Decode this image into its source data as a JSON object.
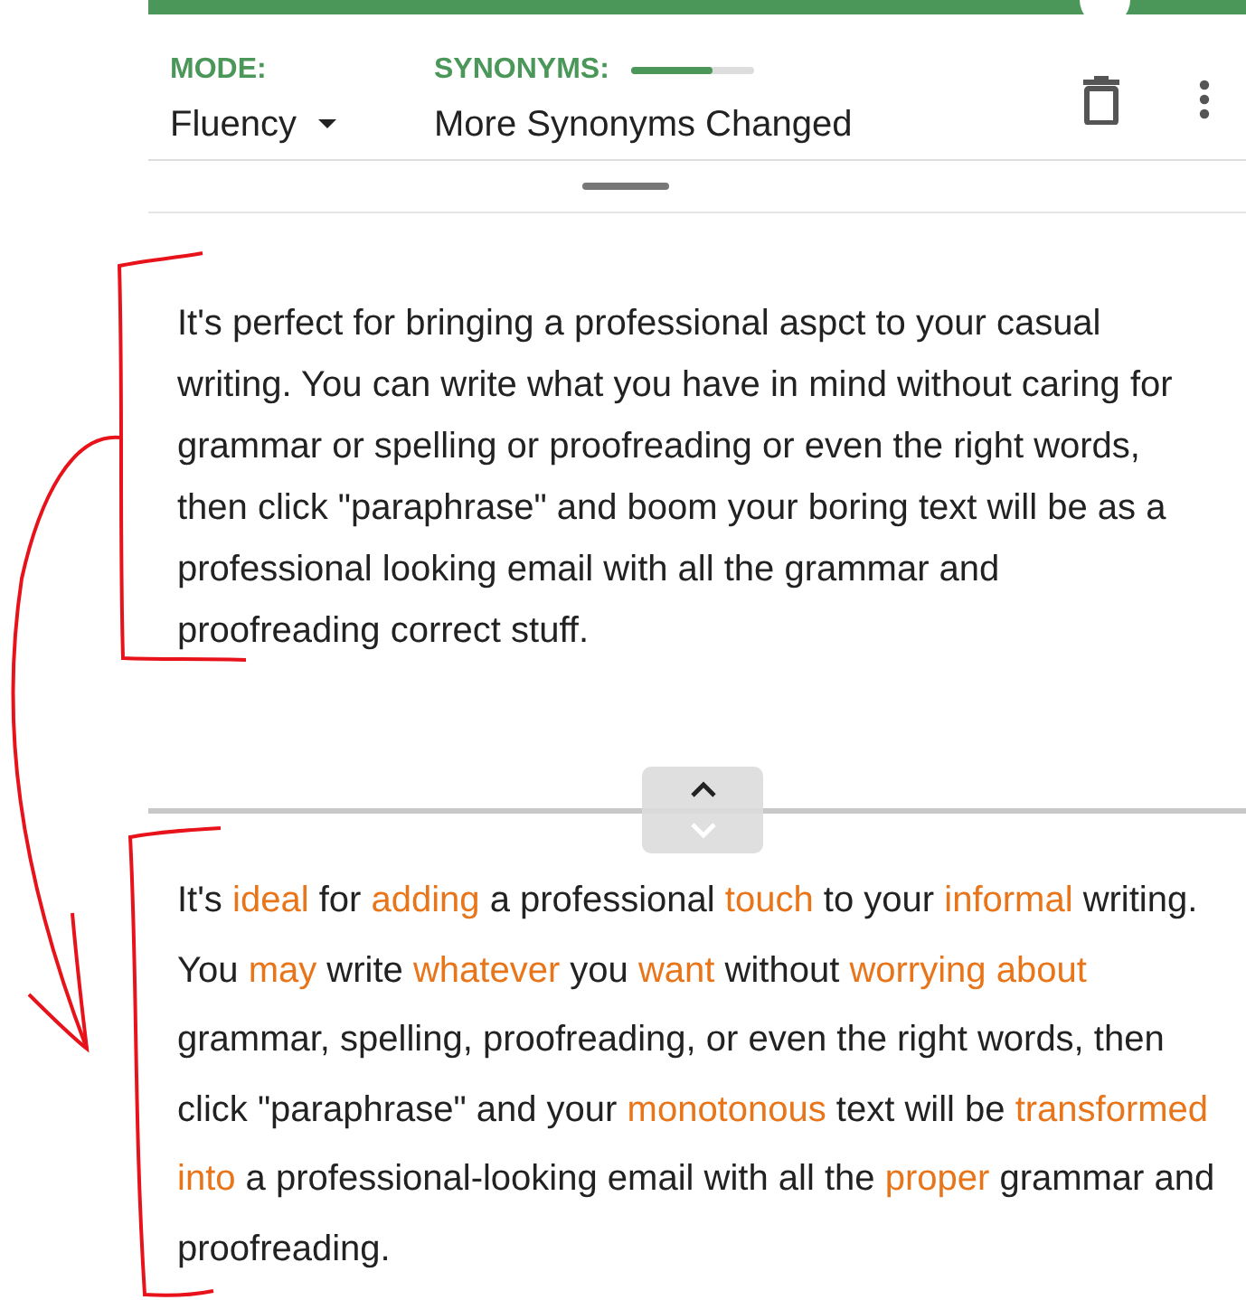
{
  "toolbar": {
    "mode_label": "MODE:",
    "mode_value": "Fluency",
    "synonyms": {
      "label": "SYNONYMS:",
      "level": 0.66,
      "value": "More Synonyms Changed"
    }
  },
  "input_text": "It's perfect for bringing a professional aspct to your casual writing. You can write what you have in mind without caring for grammar or spelling or proofreading or even the right words, then click \"paraphrase\" and boom your boring text will be as a professional looking email with all the grammar and proofreading correct stuff.",
  "output_segments": [
    {
      "text": "It's ",
      "changed": false
    },
    {
      "text": "ideal",
      "changed": true
    },
    {
      "text": " for ",
      "changed": false
    },
    {
      "text": "adding",
      "changed": true
    },
    {
      "text": " a professional ",
      "changed": false
    },
    {
      "text": "touch",
      "changed": true
    },
    {
      "text": " to your ",
      "changed": false
    },
    {
      "text": "informal",
      "changed": true
    },
    {
      "text": " writing. You ",
      "changed": false
    },
    {
      "text": "may",
      "changed": true
    },
    {
      "text": " write ",
      "changed": false
    },
    {
      "text": "whatever",
      "changed": true
    },
    {
      "text": " you ",
      "changed": false
    },
    {
      "text": "want",
      "changed": true
    },
    {
      "text": " without ",
      "changed": false
    },
    {
      "text": "worrying about",
      "changed": true
    },
    {
      "text": " grammar, spelling, proofreading, or even the right words, then click \"paraphrase\" and your ",
      "changed": false
    },
    {
      "text": "monotonous",
      "changed": true
    },
    {
      "text": " text will be ",
      "changed": false
    },
    {
      "text": "transformed into",
      "changed": true
    },
    {
      "text": " a professional-looking email with all the ",
      "changed": false
    },
    {
      "text": "proper",
      "changed": true
    },
    {
      "text": " grammar and proofreading.",
      "changed": false
    }
  ]
}
